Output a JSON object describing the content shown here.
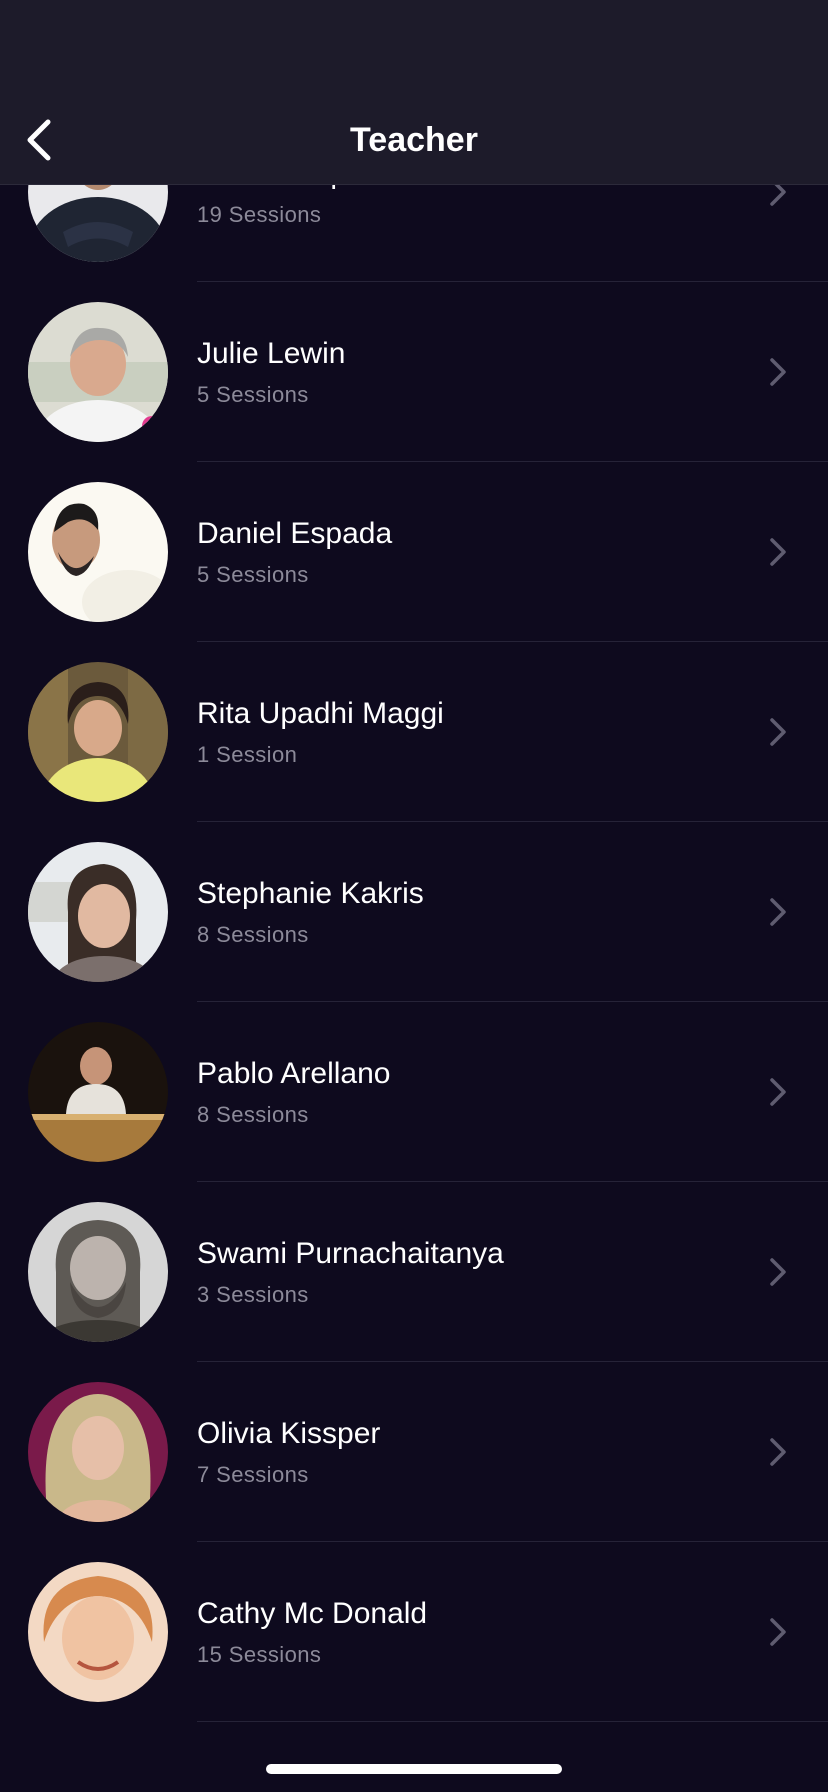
{
  "header": {
    "title": "Teacher",
    "back_icon": "chevron-left-icon"
  },
  "teachers": [
    {
      "name": "Jason Stephenson",
      "sessions": "19 Sessions",
      "avatar": "portrait-photo"
    },
    {
      "name": "Julie Lewin",
      "sessions": "5 Sessions",
      "avatar": "portrait-photo"
    },
    {
      "name": "Daniel Espada",
      "sessions": "5 Sessions",
      "avatar": "portrait-photo"
    },
    {
      "name": "Rita Upadhi Maggi",
      "sessions": "1 Session",
      "avatar": "portrait-photo"
    },
    {
      "name": "Stephanie Kakris",
      "sessions": "8 Sessions",
      "avatar": "portrait-photo"
    },
    {
      "name": "Pablo Arellano",
      "sessions": "8 Sessions",
      "avatar": "portrait-photo"
    },
    {
      "name": "Swami Purnachaitanya",
      "sessions": "3 Sessions",
      "avatar": "portrait-photo"
    },
    {
      "name": "Olivia Kissper",
      "sessions": "7 Sessions",
      "avatar": "portrait-photo"
    },
    {
      "name": "Cathy Mc Donald",
      "sessions": "15 Sessions",
      "avatar": "portrait-photo"
    }
  ],
  "colors": {
    "background": "#0e0a1e",
    "header": "#1d1b2a",
    "secondary_text": "#8c8a99",
    "divider": "#262338"
  }
}
